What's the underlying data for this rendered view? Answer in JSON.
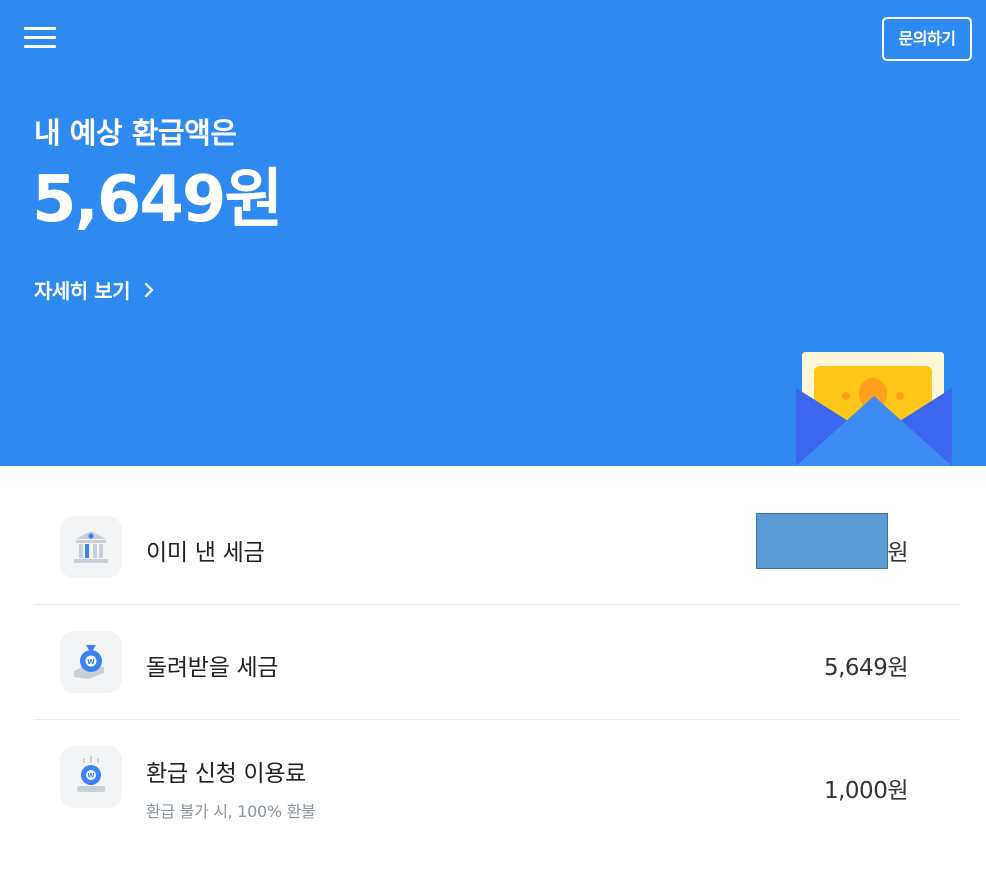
{
  "header": {
    "menu_icon": "hamburger-menu-icon",
    "inquiry_label": "문의하기"
  },
  "hero": {
    "subtitle": "내 예상 환급액은",
    "amount": "5,649원",
    "detail_link": "자세히 보기",
    "background_color": "#2e8af1",
    "illustration": "money-envelope-icon"
  },
  "list": {
    "items": [
      {
        "icon": "bank-icon",
        "label": "이미 낸 세금",
        "value": "원"
      },
      {
        "icon": "money-bag-hand-icon",
        "label": "돌려받을 세금",
        "value": "5,649원"
      },
      {
        "icon": "coin-fee-icon",
        "label": "환급 신청 이용료",
        "sublabel": "환급 불가 시, 100% 환불",
        "value": "1,000원"
      }
    ]
  }
}
